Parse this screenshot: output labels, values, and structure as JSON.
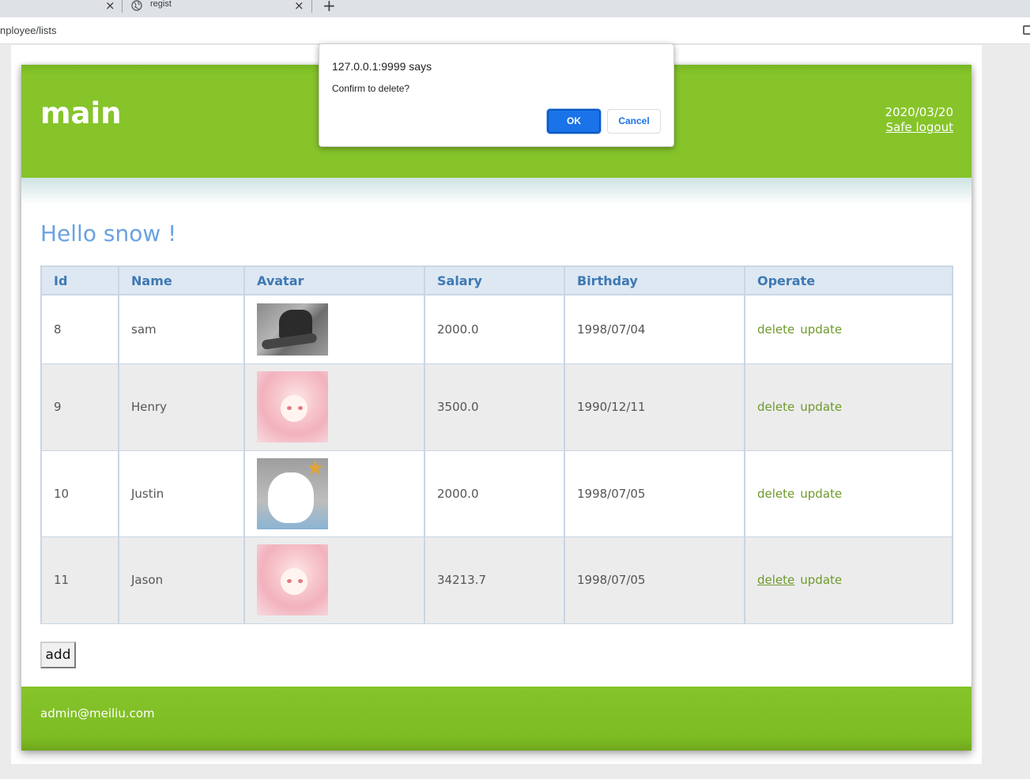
{
  "browser": {
    "tabs": [
      {
        "title": ""
      },
      {
        "title": "regist"
      }
    ],
    "address": "nployee/lists"
  },
  "header": {
    "logo": "main",
    "date": "2020/03/20",
    "logout": "Safe logout"
  },
  "greeting": "Hello snow !",
  "table": {
    "columns": [
      "Id",
      "Name",
      "Avatar",
      "Salary",
      "Birthday",
      "Operate"
    ],
    "rows": [
      {
        "id": "8",
        "name": "sam",
        "avatar": "sam",
        "salary": "2000.0",
        "birthday": "1998/07/04",
        "delete": "delete",
        "update": "update"
      },
      {
        "id": "9",
        "name": "Henry",
        "avatar": "pink",
        "salary": "3500.0",
        "birthday": "1990/12/11",
        "delete": "delete",
        "update": "update"
      },
      {
        "id": "10",
        "name": "Justin",
        "avatar": "cat",
        "salary": "2000.0",
        "birthday": "1998/07/05",
        "delete": "delete",
        "update": "update"
      },
      {
        "id": "11",
        "name": "Jason",
        "avatar": "pink",
        "salary": "34213.7",
        "birthday": "1998/07/05",
        "delete": "delete",
        "update": "update"
      }
    ]
  },
  "add_button": "add",
  "footer": "admin@meiliu.com",
  "dialog": {
    "title": "127.0.0.1:9999 says",
    "message": "Confirm to delete?",
    "ok": "OK",
    "cancel": "Cancel"
  },
  "colors": {
    "header_green": "#86c42a",
    "greeting_blue": "#6aa2e0",
    "link_green": "#6e9a2c",
    "dialog_button_blue": "#1a73e8"
  }
}
